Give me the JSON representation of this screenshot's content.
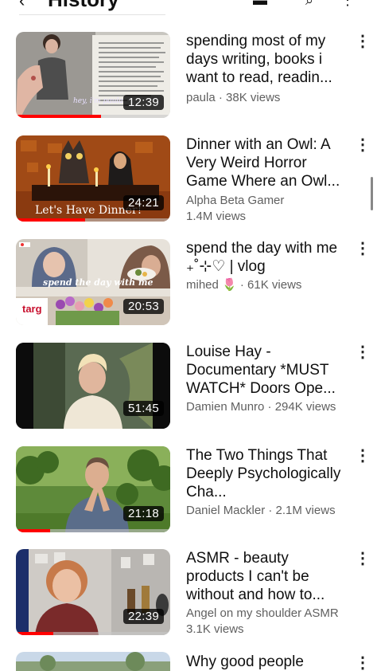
{
  "header": {
    "back_glyph": "‹",
    "title": "History"
  },
  "videos": [
    {
      "title": "spending most of my days writing, books i want to read, readin...",
      "channel": "paula",
      "views": "38K views",
      "duration": "12:39",
      "progress": 0.55,
      "overlay": "hey, i'm paula."
    },
    {
      "title": "Dinner with an Owl: A Very Weird Horror Game Where an Owl...",
      "channel": "Alpha Beta Gamer",
      "views": "1.4M views",
      "duration": "24:21",
      "progress": 0.45,
      "overlay": "Let's Have Dinner!"
    },
    {
      "title": "spend the day with me ₊˚⊹♡ | vlog",
      "channel": "mihed 🌷",
      "views": "61K views",
      "duration": "20:53",
      "progress": 0.0,
      "overlay": "spend the day with me",
      "sign": "targ"
    },
    {
      "title": "Louise Hay - Documentary *MUST WATCH* Doors Ope...",
      "channel": "Damien Munro",
      "views": "294K views",
      "duration": "51:45",
      "progress": 0.0
    },
    {
      "title": "The Two Things That Deeply Psychologically Cha...",
      "channel": "Daniel Mackler",
      "views": "2.1M views",
      "duration": "21:18",
      "progress": 0.22
    },
    {
      "title": "ASMR - beauty products I can't be without and how to...",
      "channel": "Angel on my shoulder ASMR",
      "views": "3.1K views",
      "duration": "22:39",
      "progress": 0.24
    },
    {
      "title": "Why good people"
    }
  ]
}
